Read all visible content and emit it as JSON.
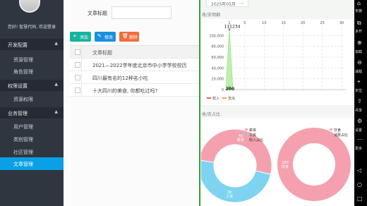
{
  "sidebar": {
    "welcome": "您好! 智慧代码, 欢迎登录",
    "groups": [
      {
        "label": "开发配置",
        "items": [
          "资源管理",
          "角色管理"
        ]
      },
      {
        "label": "权限设置",
        "items": [
          "资源权限"
        ]
      },
      {
        "label": "业务管理",
        "items": [
          "用户管理",
          "类别管理",
          "社区管理",
          "文章管理"
        ]
      }
    ],
    "active_item": "文章管理"
  },
  "content": {
    "search_label": "文章标题",
    "buttons": {
      "add": "添加",
      "edit": "修改",
      "delete": "删除"
    },
    "table": {
      "header": "文章标题",
      "rows": [
        "2021—2022学年度北京市中小学学校校历",
        "四川最有名的12种名小吃",
        "十大四川的美食, 你都吃过吗?"
      ]
    }
  },
  "panel": {
    "month": "2025年05月",
    "bar_title": "收/支明细",
    "pie_title": "收/支占比"
  },
  "chart_data": [
    {
      "type": "area",
      "title": "收/支明细",
      "x": [
        1,
        5,
        10,
        15,
        20,
        25,
        30
      ],
      "ylim": [
        0,
        120000
      ],
      "yticks": [
        "0",
        "20,000",
        "40,000",
        "60,000",
        "80,000",
        "100,000"
      ],
      "xticks": [
        "1",
        "5",
        "10",
        "15",
        "20",
        "25",
        "30"
      ],
      "series": [
        {
          "name": "收入",
          "peak_x": 1,
          "values": [
            200,
            0,
            0,
            0,
            0,
            0,
            0
          ]
        },
        {
          "name": "支出",
          "peak_x": 1,
          "values": [
            111234,
            0,
            0,
            0,
            0,
            0,
            0
          ]
        }
      ],
      "data_labels": [
        "111234",
        "200"
      ],
      "legend": [
        "收入",
        "支出"
      ],
      "colors": {
        "income": "#7dd87a",
        "expense": "#bff0a8"
      }
    },
    {
      "type": "pie",
      "title": "收/支占比",
      "legend": [
        "薪资",
        "工资",
        "收入占比"
      ],
      "slices": [
        {
          "name": "薪资",
          "label": "40\n薪资",
          "value": 40,
          "color": "#f5a0ae"
        },
        {
          "name": "工资",
          "label": "38\n工资",
          "value": 38,
          "color": "#7ed4f0"
        }
      ]
    },
    {
      "type": "pie",
      "legend": [
        "饮食",
        "消费占比"
      ],
      "slices": [
        {
          "name": "饮食",
          "label": "100\n饮食",
          "value": 100,
          "color": "#f5a0ae"
        }
      ]
    }
  ],
  "sysbar": {
    "items": [
      "安装",
      "多开",
      "加载",
      "减载",
      "定位",
      "共享",
      "设置",
      "更多"
    ]
  }
}
